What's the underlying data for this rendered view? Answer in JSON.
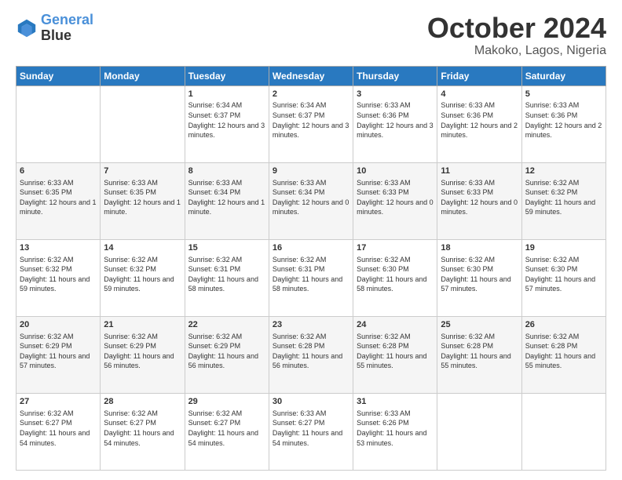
{
  "header": {
    "logo_line1": "General",
    "logo_line2": "Blue",
    "month": "October 2024",
    "location": "Makoko, Lagos, Nigeria"
  },
  "weekdays": [
    "Sunday",
    "Monday",
    "Tuesday",
    "Wednesday",
    "Thursday",
    "Friday",
    "Saturday"
  ],
  "weeks": [
    [
      {
        "day": "",
        "content": ""
      },
      {
        "day": "",
        "content": ""
      },
      {
        "day": "1",
        "content": "Sunrise: 6:34 AM\nSunset: 6:37 PM\nDaylight: 12 hours and 3 minutes."
      },
      {
        "day": "2",
        "content": "Sunrise: 6:34 AM\nSunset: 6:37 PM\nDaylight: 12 hours and 3 minutes."
      },
      {
        "day": "3",
        "content": "Sunrise: 6:33 AM\nSunset: 6:36 PM\nDaylight: 12 hours and 3 minutes."
      },
      {
        "day": "4",
        "content": "Sunrise: 6:33 AM\nSunset: 6:36 PM\nDaylight: 12 hours and 2 minutes."
      },
      {
        "day": "5",
        "content": "Sunrise: 6:33 AM\nSunset: 6:36 PM\nDaylight: 12 hours and 2 minutes."
      }
    ],
    [
      {
        "day": "6",
        "content": "Sunrise: 6:33 AM\nSunset: 6:35 PM\nDaylight: 12 hours and 1 minute."
      },
      {
        "day": "7",
        "content": "Sunrise: 6:33 AM\nSunset: 6:35 PM\nDaylight: 12 hours and 1 minute."
      },
      {
        "day": "8",
        "content": "Sunrise: 6:33 AM\nSunset: 6:34 PM\nDaylight: 12 hours and 1 minute."
      },
      {
        "day": "9",
        "content": "Sunrise: 6:33 AM\nSunset: 6:34 PM\nDaylight: 12 hours and 0 minutes."
      },
      {
        "day": "10",
        "content": "Sunrise: 6:33 AM\nSunset: 6:33 PM\nDaylight: 12 hours and 0 minutes."
      },
      {
        "day": "11",
        "content": "Sunrise: 6:33 AM\nSunset: 6:33 PM\nDaylight: 12 hours and 0 minutes."
      },
      {
        "day": "12",
        "content": "Sunrise: 6:32 AM\nSunset: 6:32 PM\nDaylight: 11 hours and 59 minutes."
      }
    ],
    [
      {
        "day": "13",
        "content": "Sunrise: 6:32 AM\nSunset: 6:32 PM\nDaylight: 11 hours and 59 minutes."
      },
      {
        "day": "14",
        "content": "Sunrise: 6:32 AM\nSunset: 6:32 PM\nDaylight: 11 hours and 59 minutes."
      },
      {
        "day": "15",
        "content": "Sunrise: 6:32 AM\nSunset: 6:31 PM\nDaylight: 11 hours and 58 minutes."
      },
      {
        "day": "16",
        "content": "Sunrise: 6:32 AM\nSunset: 6:31 PM\nDaylight: 11 hours and 58 minutes."
      },
      {
        "day": "17",
        "content": "Sunrise: 6:32 AM\nSunset: 6:30 PM\nDaylight: 11 hours and 58 minutes."
      },
      {
        "day": "18",
        "content": "Sunrise: 6:32 AM\nSunset: 6:30 PM\nDaylight: 11 hours and 57 minutes."
      },
      {
        "day": "19",
        "content": "Sunrise: 6:32 AM\nSunset: 6:30 PM\nDaylight: 11 hours and 57 minutes."
      }
    ],
    [
      {
        "day": "20",
        "content": "Sunrise: 6:32 AM\nSunset: 6:29 PM\nDaylight: 11 hours and 57 minutes."
      },
      {
        "day": "21",
        "content": "Sunrise: 6:32 AM\nSunset: 6:29 PM\nDaylight: 11 hours and 56 minutes."
      },
      {
        "day": "22",
        "content": "Sunrise: 6:32 AM\nSunset: 6:29 PM\nDaylight: 11 hours and 56 minutes."
      },
      {
        "day": "23",
        "content": "Sunrise: 6:32 AM\nSunset: 6:28 PM\nDaylight: 11 hours and 56 minutes."
      },
      {
        "day": "24",
        "content": "Sunrise: 6:32 AM\nSunset: 6:28 PM\nDaylight: 11 hours and 55 minutes."
      },
      {
        "day": "25",
        "content": "Sunrise: 6:32 AM\nSunset: 6:28 PM\nDaylight: 11 hours and 55 minutes."
      },
      {
        "day": "26",
        "content": "Sunrise: 6:32 AM\nSunset: 6:28 PM\nDaylight: 11 hours and 55 minutes."
      }
    ],
    [
      {
        "day": "27",
        "content": "Sunrise: 6:32 AM\nSunset: 6:27 PM\nDaylight: 11 hours and 54 minutes."
      },
      {
        "day": "28",
        "content": "Sunrise: 6:32 AM\nSunset: 6:27 PM\nDaylight: 11 hours and 54 minutes."
      },
      {
        "day": "29",
        "content": "Sunrise: 6:32 AM\nSunset: 6:27 PM\nDaylight: 11 hours and 54 minutes."
      },
      {
        "day": "30",
        "content": "Sunrise: 6:33 AM\nSunset: 6:27 PM\nDaylight: 11 hours and 54 minutes."
      },
      {
        "day": "31",
        "content": "Sunrise: 6:33 AM\nSunset: 6:26 PM\nDaylight: 11 hours and 53 minutes."
      },
      {
        "day": "",
        "content": ""
      },
      {
        "day": "",
        "content": ""
      }
    ]
  ]
}
